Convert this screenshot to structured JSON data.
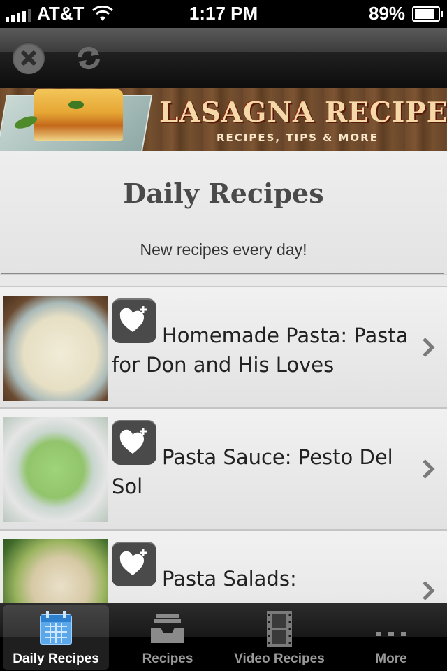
{
  "status_bar": {
    "carrier": "AT&T",
    "time": "1:17 PM",
    "battery": "89%"
  },
  "toolbar": {
    "close_icon": "close-icon",
    "refresh_icon": "refresh-icon"
  },
  "banner": {
    "title": "LASAGNA RECIPES",
    "subtitle": "RECIPES, TIPS & MORE"
  },
  "header": {
    "title": "Daily Recipes",
    "subtitle": "New recipes every day!"
  },
  "recipes": [
    {
      "title": "Homemade Pasta: Pasta for Don and His Loves",
      "thumb": "pasta-photo"
    },
    {
      "title": "Pasta Sauce: Pesto Del Sol",
      "thumb": "pesto-photo"
    },
    {
      "title": "Pasta Salads:",
      "thumb": "salad-photo"
    }
  ],
  "tabs": [
    {
      "label": "Daily Recipes",
      "icon": "calendar-icon",
      "active": true
    },
    {
      "label": "Recipes",
      "icon": "inbox-tray-icon",
      "active": false
    },
    {
      "label": "Video Recipes",
      "icon": "film-strip-icon",
      "active": false
    },
    {
      "label": "More",
      "icon": "more-dots-icon",
      "active": false
    }
  ],
  "colors": {
    "tab_active": "#8fc4f0",
    "fav_icon_bg": "#4a4a4a"
  }
}
